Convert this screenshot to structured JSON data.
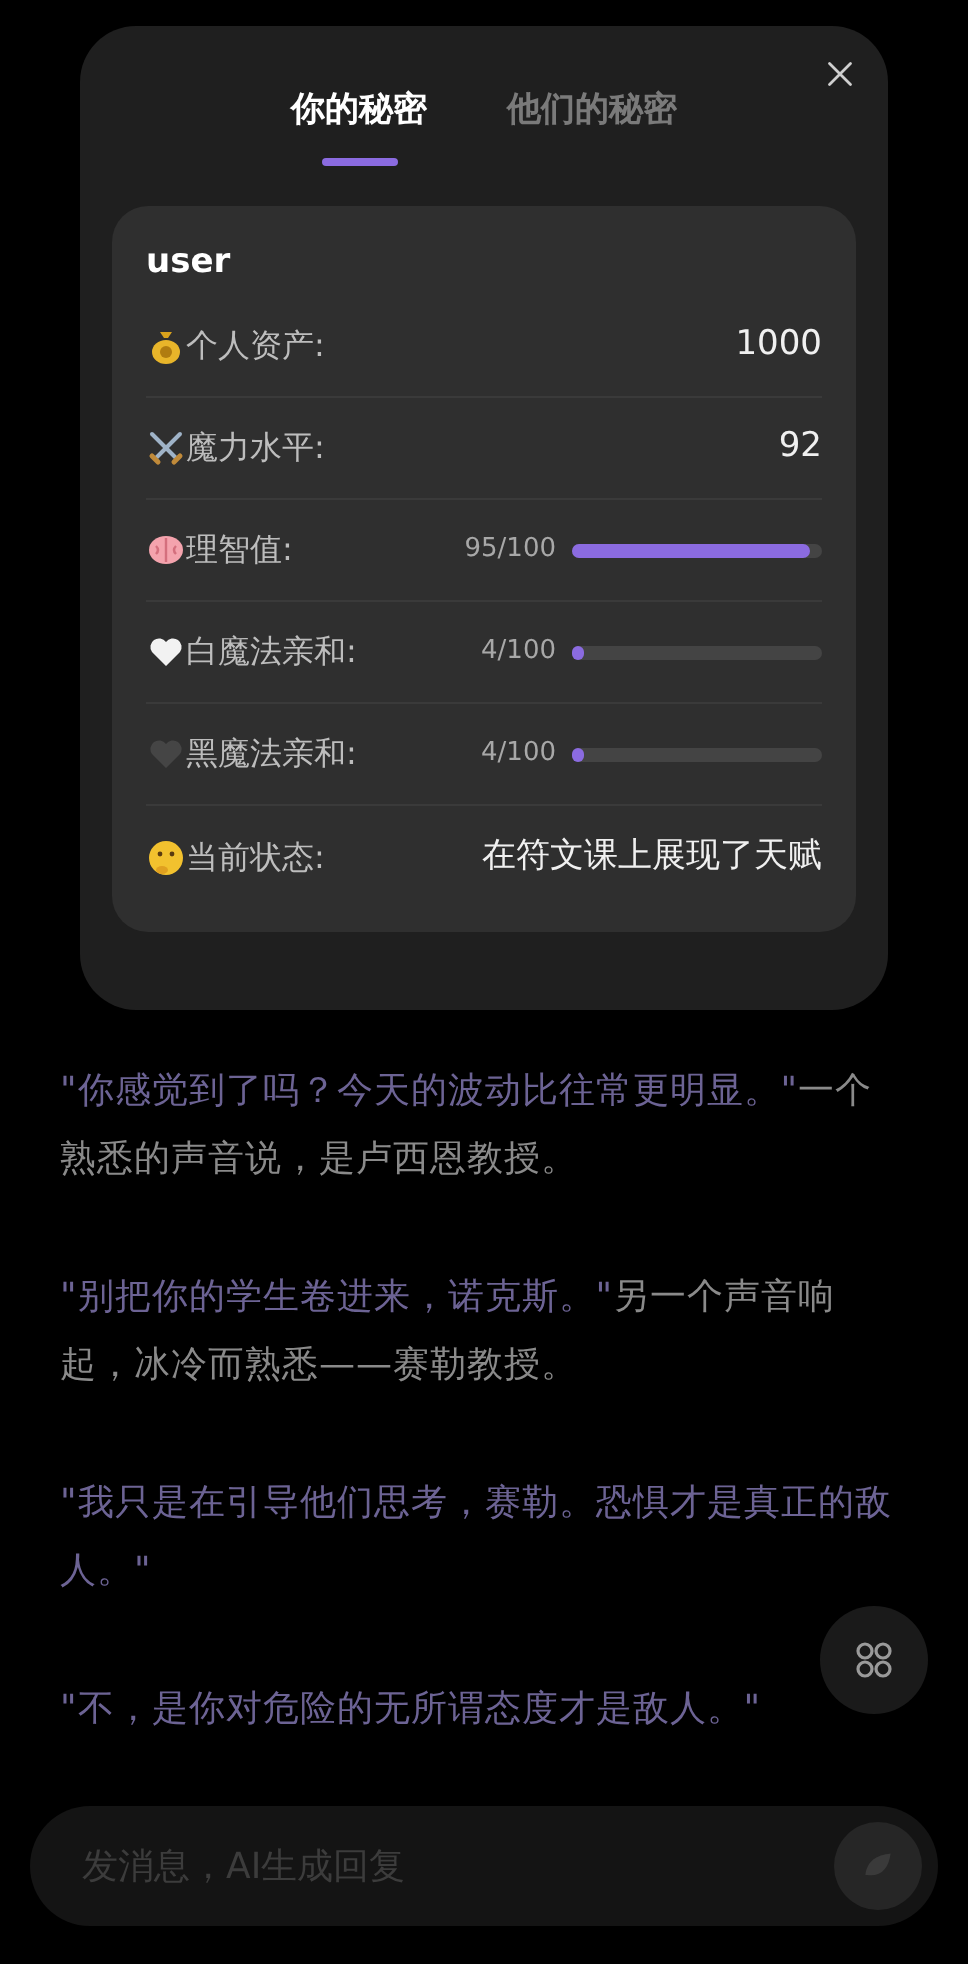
{
  "panel": {
    "tabs": [
      {
        "label": "你的秘密",
        "selected": true
      },
      {
        "label": "他们的秘密",
        "selected": false
      }
    ],
    "card": {
      "title": "user",
      "rows": [
        {
          "kind": "value",
          "label": "个人资产:",
          "value": "1000"
        },
        {
          "kind": "value",
          "label": "魔力水平:",
          "value": "92"
        },
        {
          "kind": "bar",
          "label": "理智值:",
          "reading": "95/100",
          "level": 0.95
        },
        {
          "kind": "bar",
          "label": "白魔法亲和:",
          "reading": "4/100",
          "level": 0.04
        },
        {
          "kind": "bar",
          "label": "黑魔法亲和:",
          "reading": "4/100",
          "level": 0.04
        },
        {
          "kind": "value",
          "label": "当前状态:",
          "value": "在符文课上展现了天赋"
        }
      ]
    }
  },
  "story": [
    [
      {
        "kind": "dialogue",
        "text": "\"你感觉到了吗？今天的波动比往常更明显。\""
      },
      {
        "kind": "narration",
        "text": "一个熟悉的声音说，是卢西恩教授。"
      }
    ],
    [
      {
        "kind": "dialogue",
        "text": "\"别把你的学生卷进来，诺克斯。\""
      },
      {
        "kind": "narration",
        "text": "另一个声音响起，冰冷而熟悉——赛勒教授。"
      }
    ],
    [
      {
        "kind": "dialogue",
        "text": "\"我只是在引导他们思考，赛勒。恐惧才是真正的敌人。\""
      }
    ],
    [
      {
        "kind": "dialogue",
        "text": "\"不，是你对危险的无所谓态度才是敌人。\""
      }
    ]
  ],
  "composer": {
    "placeholder": "发消息，AI生成回复"
  }
}
